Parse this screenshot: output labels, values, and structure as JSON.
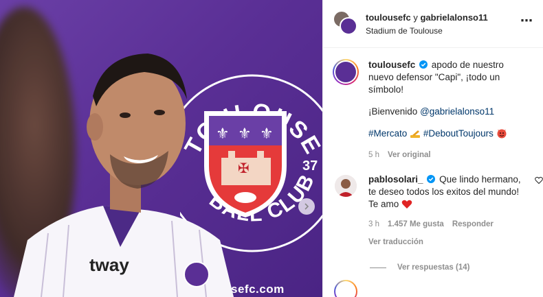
{
  "post_image": {
    "crest_text_top": "TOULOUSE",
    "crest_text_bottom": "BALL CLUB",
    "crest_number": "37",
    "website": "sefc.com",
    "shirt_sponsor": "tway"
  },
  "header": {
    "user1": "toulousefc",
    "connector": " y ",
    "user2": "gabrielalonso11",
    "location": "Stadium de Toulouse",
    "more_icon": "⋯"
  },
  "caption": {
    "username": "toulousefc",
    "text_line": "apodo de nuestro nuevo defensor \"Capi\", ¡todo un símbolo!",
    "welcome_prefix": "¡Bienvenido ",
    "welcome_mention": "@gabrielalonso11",
    "hashtag1": "#Mercato",
    "hashtag2": "#DeboutToujours",
    "time": "5 h",
    "see_original": "Ver original"
  },
  "comment": {
    "username": "pablosolari_",
    "text": "Que lindo hermano, te deseo todos los exitos del mundo! Te amo",
    "time": "3 h",
    "likes": "1.457 Me gusta",
    "reply": "Responder",
    "see_translation": "Ver traducción",
    "view_replies": "Ver respuestas (14)"
  },
  "colors": {
    "club_purple": "#5a2f95",
    "link_blue": "#00376b",
    "verified_blue": "#0095f6",
    "muted_gray": "#8e8e8e",
    "heart_red": "#ed4956"
  }
}
